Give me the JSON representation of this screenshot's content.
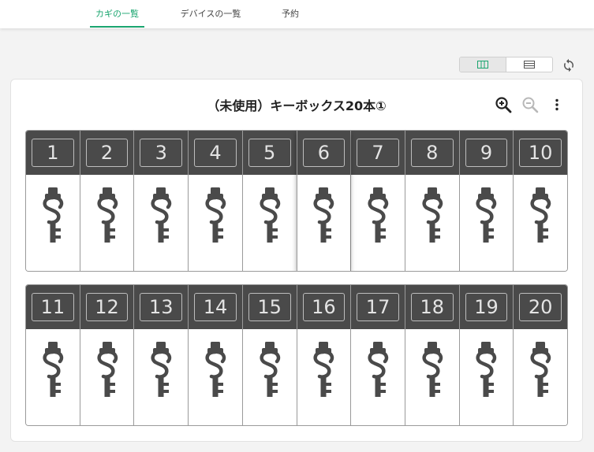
{
  "nav": {
    "tabs": [
      {
        "label": "カギの一覧",
        "active": true
      },
      {
        "label": "デバイスの一覧",
        "active": false
      },
      {
        "label": "予約",
        "active": false
      }
    ]
  },
  "toolbar": {
    "view_options": [
      "column-view-icon",
      "row-view-icon"
    ],
    "selected_view": "column-view-icon",
    "refresh_icon": "refresh-icon"
  },
  "panel": {
    "title": "（未使用）キーボックス20本①",
    "tools": [
      "zoom-in-icon",
      "zoom-out-icon",
      "more-vert-icon"
    ]
  },
  "keybox": {
    "rows": [
      {
        "slots": [
          "1",
          "2",
          "3",
          "4",
          "5",
          "6",
          "7",
          "8",
          "9",
          "10"
        ]
      },
      {
        "slots": [
          "11",
          "12",
          "13",
          "14",
          "15",
          "16",
          "17",
          "18",
          "19",
          "20"
        ]
      }
    ],
    "highlighted_slot": "6"
  },
  "colors": {
    "accent": "#1aa56f",
    "slot_header": "#4a4a4a",
    "key_icon": "#4a4a4a"
  }
}
